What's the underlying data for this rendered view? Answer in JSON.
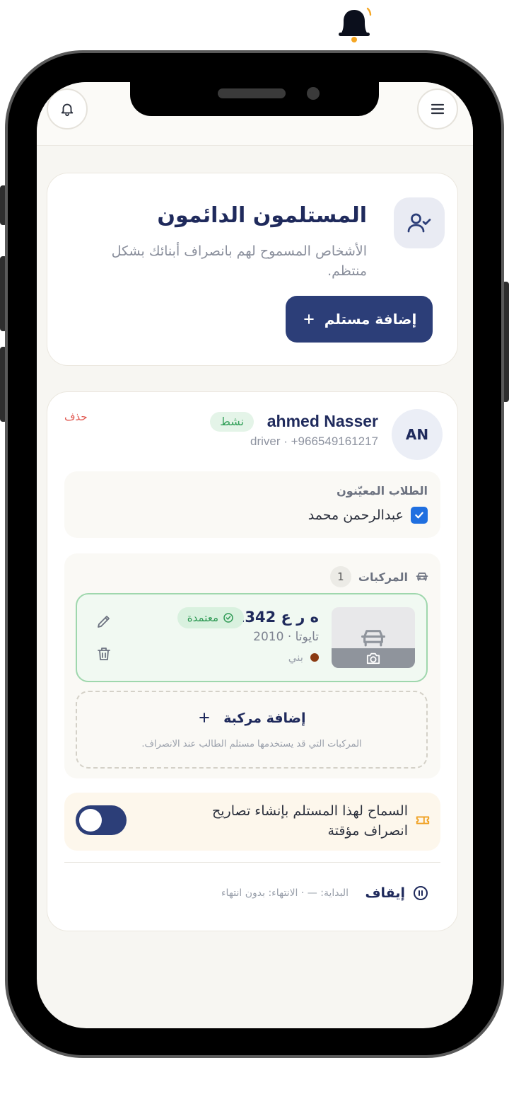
{
  "header": {
    "title": "المستلمون الدائمون",
    "description": "الأشخاص المسموح لهم بانصراف أبنائك بشكل منتظم.",
    "add_button_label": "إضافة مستلم"
  },
  "recipient": {
    "initials": "AN",
    "name": "ahmed Nasser",
    "status": "نشط",
    "subtitle": "driver · +966549161217",
    "delete_label": "حذف",
    "students_title": "الطلاب المعيّنون",
    "students": [
      {
        "name": "عبدالرحمن محمد",
        "checked": true
      }
    ],
    "vehicles_title": "المركبات",
    "vehicles_count": "1",
    "vehicle": {
      "plate": "ه ر ع 1342",
      "status": "معتمدة",
      "model": "تايوتا · 2010",
      "color_name": "بني",
      "color_hex": "#8b3a12"
    },
    "add_vehicle_label": "إضافة مركبة",
    "add_vehicle_hint": "المركبات التي قد يستخدمها مستلم الطالب عند الانصراف.",
    "permission_text": "السماح لهذا المستلم بإنشاء تصاريح انصراف مؤقتة",
    "permission_enabled": true,
    "stop_label": "إيقاف",
    "period_text": "البداية: — · الانتهاء: بدون انتهاء"
  },
  "colors": {
    "primary": "#2c3e78",
    "success": "#34a05a",
    "danger": "#e0564e",
    "notification": "#f5a623"
  },
  "icons": [
    "bell-icon",
    "menu-icon",
    "notification-bell-icon",
    "user-check-icon",
    "plus-icon",
    "checkbox-icon",
    "car-icon",
    "check-circle-icon",
    "camera-icon",
    "edit-icon",
    "trash-icon",
    "ticket-icon",
    "pause-icon"
  ]
}
